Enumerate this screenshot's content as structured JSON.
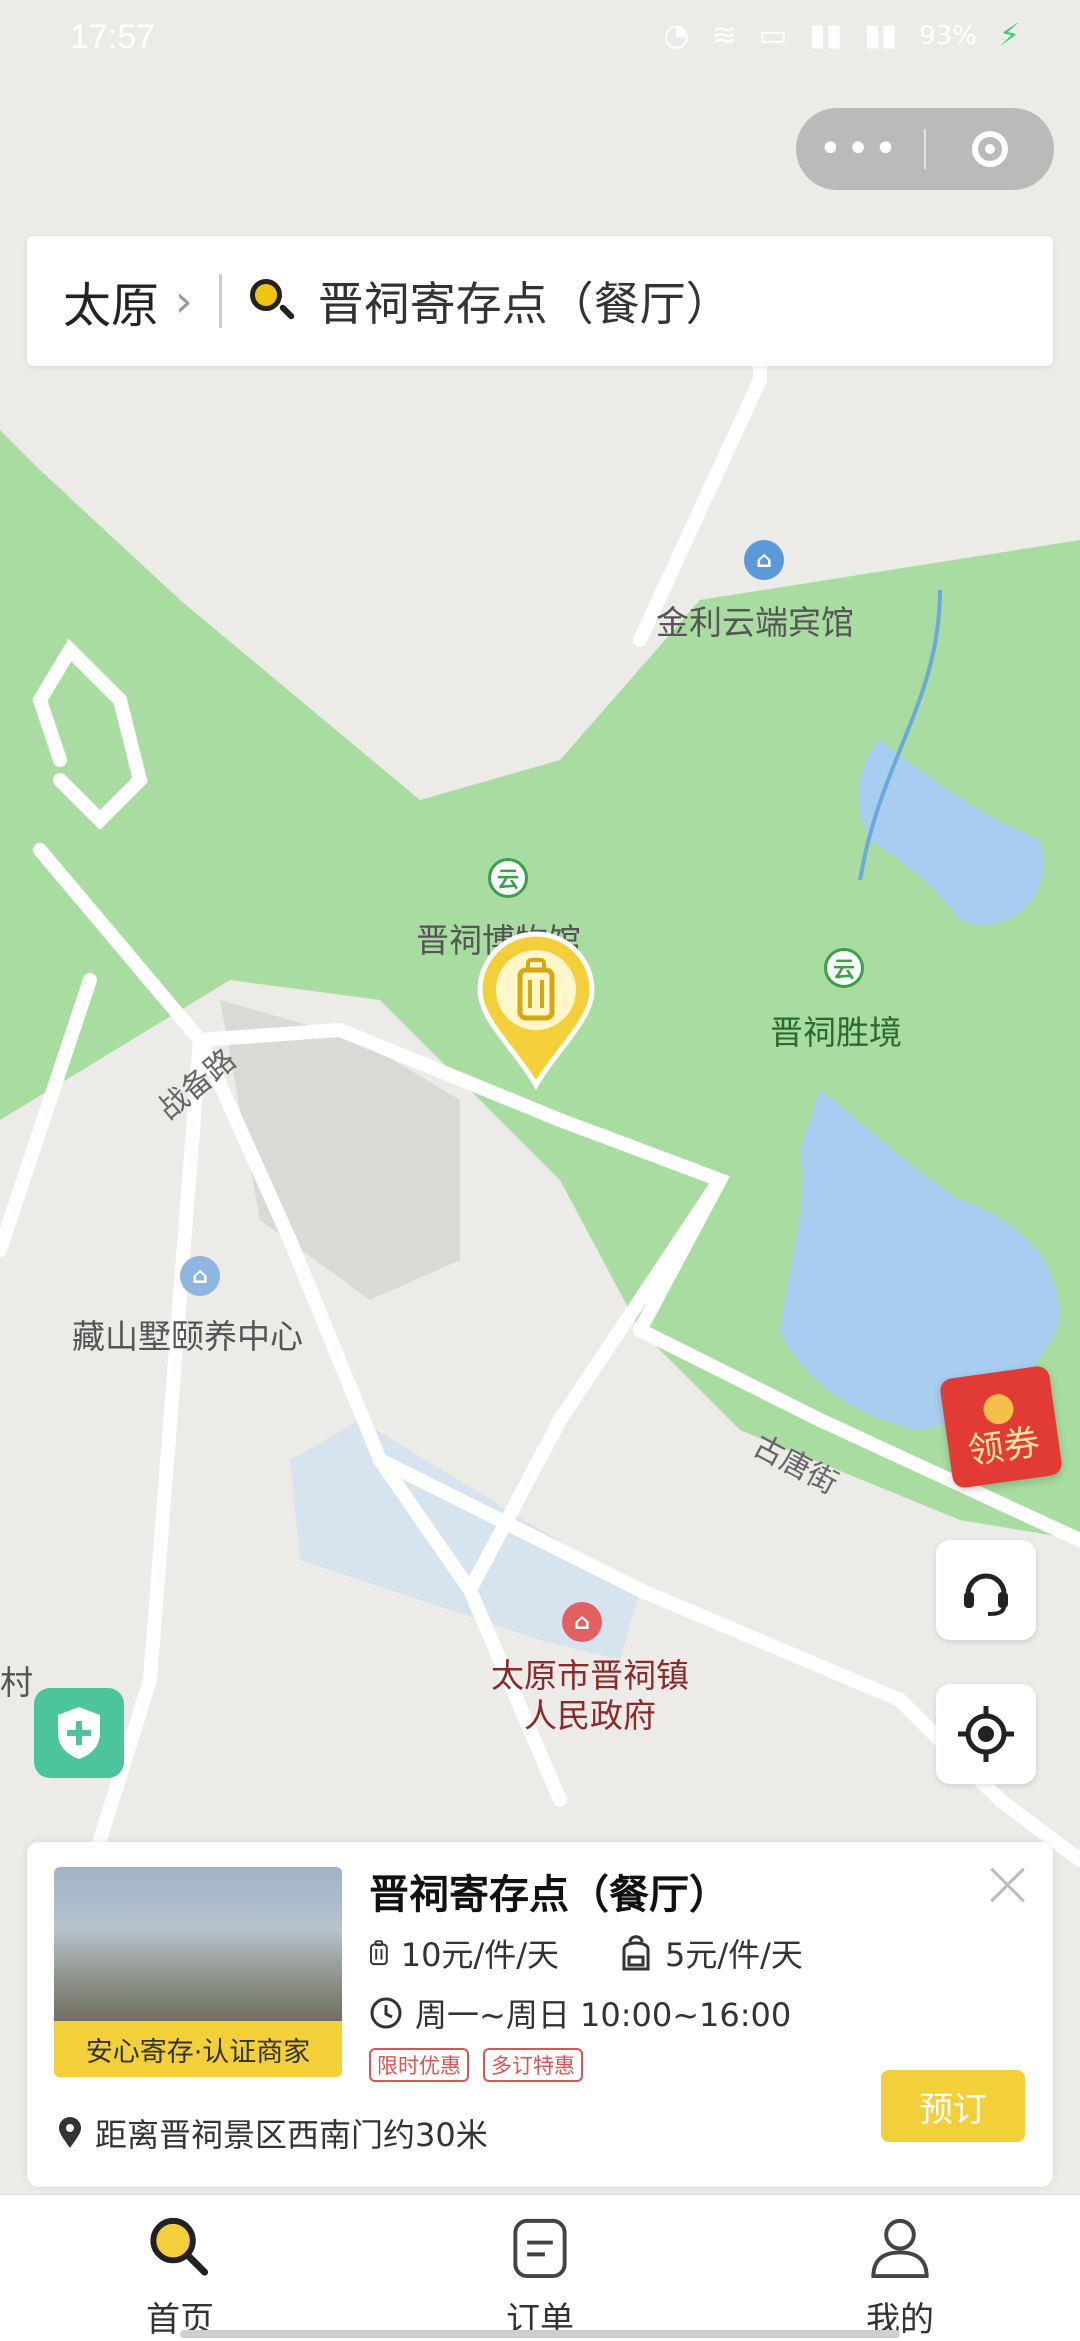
{
  "status_bar": {
    "time": "17:57",
    "battery": "93%"
  },
  "mini_program_capsule": {
    "more_icon": "more-dots-icon",
    "close_icon": "target-circle-icon"
  },
  "search_bar": {
    "city": "太原",
    "query": "晋祠寄存点（餐厅）"
  },
  "map": {
    "labels": {
      "hotel": "金利云端宾馆",
      "museum": "晋祠博物馆",
      "scenic": "晋祠胜境",
      "road_zhanbei": "战备路",
      "road_gutang": "古唐街",
      "care_center": "藏山墅颐养中心",
      "government_line1": "太原市晋祠镇",
      "government_line2": "人民政府",
      "edge_village": "村"
    }
  },
  "controls": {
    "coupon": "领券"
  },
  "store_card": {
    "name": "晋祠寄存点（餐厅）",
    "badge": "安心寄存·认证商家",
    "price_large": "10元/件/天",
    "price_small": "5元/件/天",
    "hours": "周一~周日 10:00~16:00",
    "tags": [
      "限时优惠",
      "多订特惠"
    ],
    "distance": "距离晋祠景区西南门约30米",
    "book_label": "预订"
  },
  "tab_bar": {
    "tabs": [
      {
        "label": "首页",
        "icon": "search-icon"
      },
      {
        "label": "订单",
        "icon": "order-icon"
      },
      {
        "label": "我的",
        "icon": "user-icon"
      }
    ]
  },
  "colors": {
    "accent": "#f3cf3a",
    "park_green": "#a8dca0",
    "water": "#a7cdf0"
  }
}
